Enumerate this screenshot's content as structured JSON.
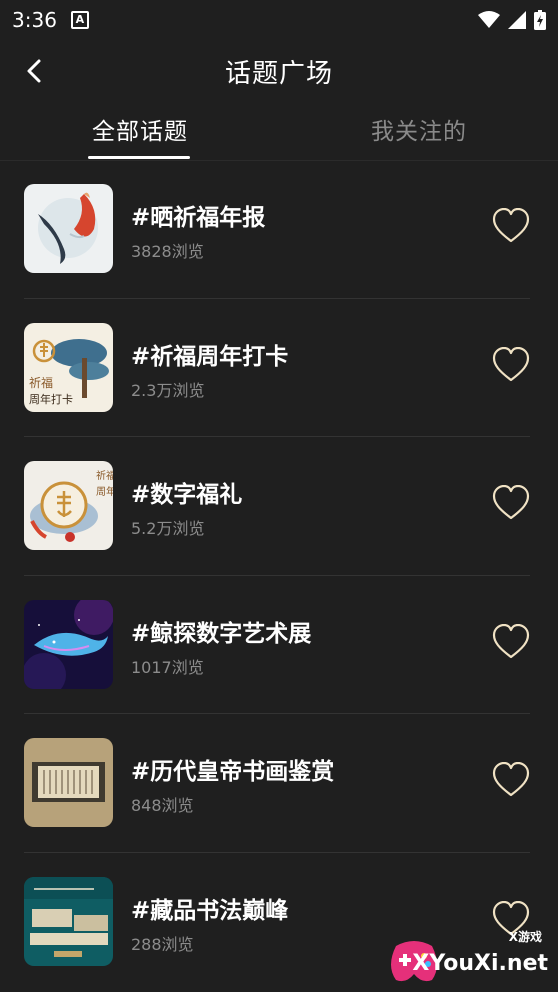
{
  "status_bar": {
    "time": "3:36",
    "notification_letter": "A"
  },
  "header": {
    "title": "话题广场"
  },
  "tabs": [
    {
      "label": "全部话题",
      "active": true
    },
    {
      "label": "我关注的",
      "active": false
    }
  ],
  "topics": [
    {
      "name": "#晒祈福年报",
      "views": "3828浏览",
      "thumb": "koi-fish",
      "followed": false
    },
    {
      "name": "#祈福周年打卡",
      "views": "2.3万浏览",
      "thumb": "pine-tree",
      "thumb_text": [
        "祈福",
        "周年打卡"
      ],
      "followed": false
    },
    {
      "name": "#数字福礼",
      "views": "5.2万浏览",
      "thumb": "fortune-seal",
      "thumb_text": [
        "祈福",
        "周年"
      ],
      "followed": false
    },
    {
      "name": "#鲸探数字艺术展",
      "views": "1017浏览",
      "thumb": "whale",
      "followed": false
    },
    {
      "name": "#历代皇帝书画鉴赏",
      "views": "848浏览",
      "thumb": "scroll",
      "followed": false
    },
    {
      "name": "#藏品书法巅峰",
      "views": "288浏览",
      "thumb": "calligraphy",
      "followed": false
    }
  ],
  "watermark": {
    "small": "X游戏",
    "text": "XYouXi.net"
  },
  "colors": {
    "background": "#1f1f1f",
    "heart": "#f0e2c4",
    "views": "#8c8c8c"
  }
}
